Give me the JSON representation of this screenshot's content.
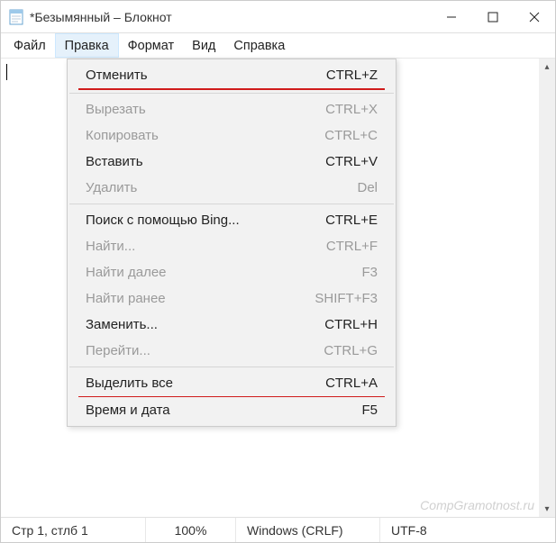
{
  "window": {
    "title": "*Безымянный – Блокнот"
  },
  "menubar": {
    "items": [
      {
        "label": "Файл"
      },
      {
        "label": "Правка"
      },
      {
        "label": "Формат"
      },
      {
        "label": "Вид"
      },
      {
        "label": "Справка"
      }
    ],
    "active_index": 1
  },
  "dropdown": {
    "groups": [
      [
        {
          "label": "Отменить",
          "shortcut": "CTRL+Z",
          "enabled": true,
          "underline": true
        }
      ],
      [
        {
          "label": "Вырезать",
          "shortcut": "CTRL+X",
          "enabled": false
        },
        {
          "label": "Копировать",
          "shortcut": "CTRL+C",
          "enabled": false
        },
        {
          "label": "Вставить",
          "shortcut": "CTRL+V",
          "enabled": true
        },
        {
          "label": "Удалить",
          "shortcut": "Del",
          "enabled": false
        }
      ],
      [
        {
          "label": "Поиск с помощью Bing...",
          "shortcut": "CTRL+E",
          "enabled": true
        },
        {
          "label": "Найти...",
          "shortcut": "CTRL+F",
          "enabled": false
        },
        {
          "label": "Найти далее",
          "shortcut": "F3",
          "enabled": false
        },
        {
          "label": "Найти ранее",
          "shortcut": "SHIFT+F3",
          "enabled": false
        },
        {
          "label": "Заменить...",
          "shortcut": "CTRL+H",
          "enabled": true
        },
        {
          "label": "Перейти...",
          "shortcut": "CTRL+G",
          "enabled": false
        }
      ],
      [
        {
          "label": "Выделить все",
          "shortcut": "CTRL+A",
          "enabled": true,
          "underline": true
        },
        {
          "label": "Время и дата",
          "shortcut": "F5",
          "enabled": true
        }
      ]
    ]
  },
  "statusbar": {
    "position": "Стр 1, стлб 1",
    "zoom": "100%",
    "line_ending": "Windows (CRLF)",
    "encoding": "UTF-8"
  },
  "watermark": "CompGramotnost.ru"
}
